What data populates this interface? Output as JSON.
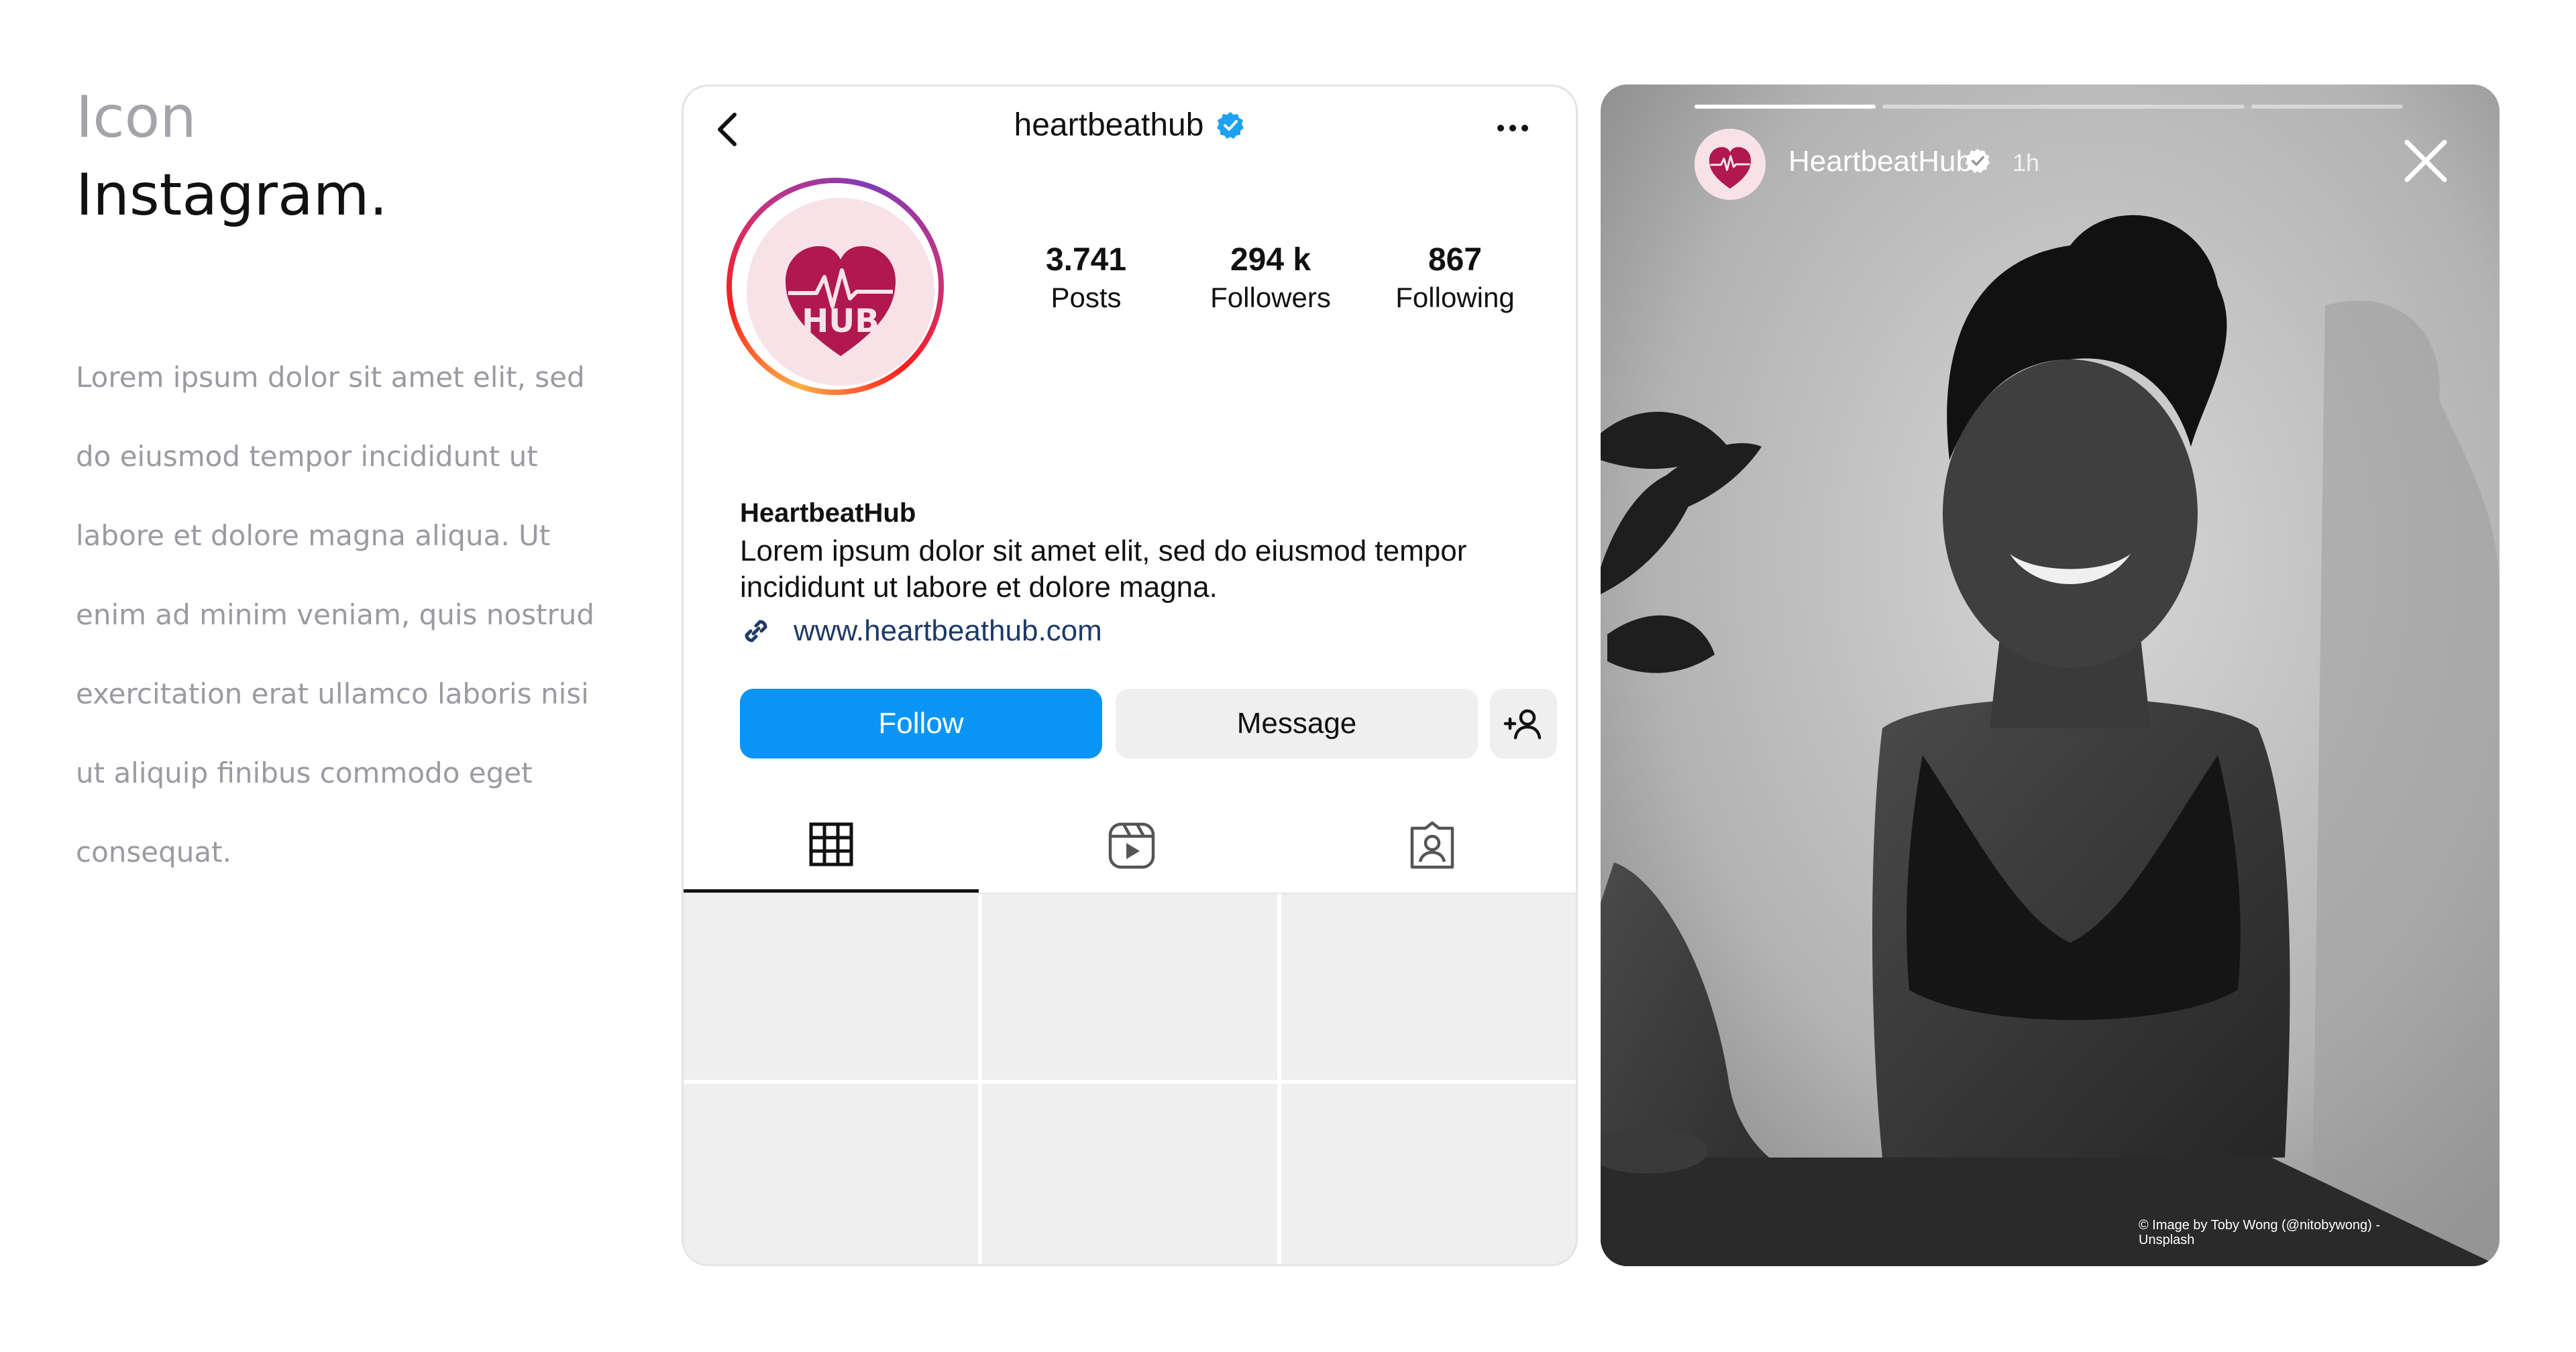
{
  "intro": {
    "label": "Icon",
    "heading": "Instagram.",
    "paragraph": "Lorem ipsum dolor sit amet elit, sed do eiusmod tempor incididunt ut labore et dolore magna aliqua. Ut enim ad minim veniam, quis nostrud exercitation erat ullamco laboris nisi ut aliquip finibus commodo eget consequat."
  },
  "profile": {
    "username": "heartbeathub",
    "display_name": "HeartbeatHub",
    "bio": "Lorem ipsum dolor sit amet elit, sed do eiusmod tempor incididunt ut labore et dolore magna.",
    "website": "www.heartbeathub.com",
    "stats": [
      {
        "value": "3.741",
        "label": "Posts"
      },
      {
        "value": "294 k",
        "label": "Followers"
      },
      {
        "value": "867",
        "label": "Following"
      }
    ],
    "buttons": {
      "follow": "Follow",
      "message": "Message"
    },
    "tabs": [
      {
        "icon": "grid-icon",
        "active": true
      },
      {
        "icon": "reels-icon",
        "active": false
      },
      {
        "icon": "tagged-icon",
        "active": false
      }
    ],
    "colors": {
      "follow_blue": "#0a95f6",
      "verified_blue": "#1da1f2",
      "brand_heart": "#b0184f"
    }
  },
  "story": {
    "name": "HeartbeatHub",
    "time": "1h",
    "progress": [
      1.0,
      0.0,
      0.0
    ],
    "credit": "© Image by Toby Wong (@nitobywong) - Unsplash"
  }
}
